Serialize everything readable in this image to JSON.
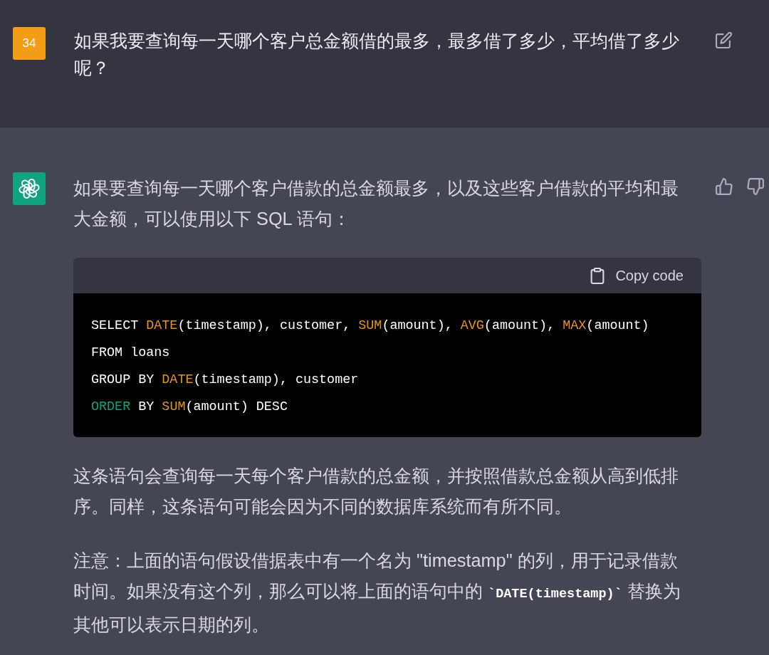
{
  "user_message": {
    "avatar": "34",
    "text": "如果我要查询每一天哪个客户总金额借的最多，最多借了多少，平均借了多少呢？"
  },
  "assistant_message": {
    "blocks": [
      {
        "kind": "paragraph",
        "segments": [
          {
            "kind": "text",
            "text": "如果要查询每一天哪个客户借款的总金额最多，以及这些客户借款的平均和最大金额，可以使用以下 SQL 语句："
          }
        ]
      },
      {
        "kind": "code",
        "copy_label": "Copy code",
        "lines": [
          [
            {
              "kind": "plain",
              "text": "SELECT "
            },
            {
              "kind": "function",
              "text": "DATE"
            },
            {
              "kind": "plain",
              "text": "(timestamp), customer, "
            },
            {
              "kind": "function",
              "text": "SUM"
            },
            {
              "kind": "plain",
              "text": "(amount), "
            },
            {
              "kind": "function",
              "text": "AVG"
            },
            {
              "kind": "plain",
              "text": "(amount), "
            },
            {
              "kind": "function",
              "text": "MAX"
            },
            {
              "kind": "plain",
              "text": "(amount)"
            }
          ],
          [
            {
              "kind": "plain",
              "text": "FROM loans"
            }
          ],
          [
            {
              "kind": "plain",
              "text": "GROUP BY "
            },
            {
              "kind": "function",
              "text": "DATE"
            },
            {
              "kind": "plain",
              "text": "(timestamp), customer"
            }
          ],
          [
            {
              "kind": "keyword",
              "text": "ORDER"
            },
            {
              "kind": "plain",
              "text": " BY "
            },
            {
              "kind": "function",
              "text": "SUM"
            },
            {
              "kind": "plain",
              "text": "(amount) DESC"
            }
          ]
        ]
      },
      {
        "kind": "paragraph",
        "segments": [
          {
            "kind": "text",
            "text": "这条语句会查询每一天每个客户借款的总金额，并按照借款总金额从高到低排序。同样，这条语句可能会因为不同的数据库系统而有所不同。"
          }
        ]
      },
      {
        "kind": "paragraph",
        "segments": [
          {
            "kind": "text",
            "text": "注意：上面的语句假设借据表中有一个名为 \"timestamp\" 的列，用于记录借款时间。如果没有这个列，那么可以将上面的语句中的 "
          },
          {
            "kind": "code",
            "text": "`DATE(timestamp)`"
          },
          {
            "kind": "text",
            "text": " 替换为其他可以表示日期的列。"
          }
        ]
      }
    ]
  }
}
